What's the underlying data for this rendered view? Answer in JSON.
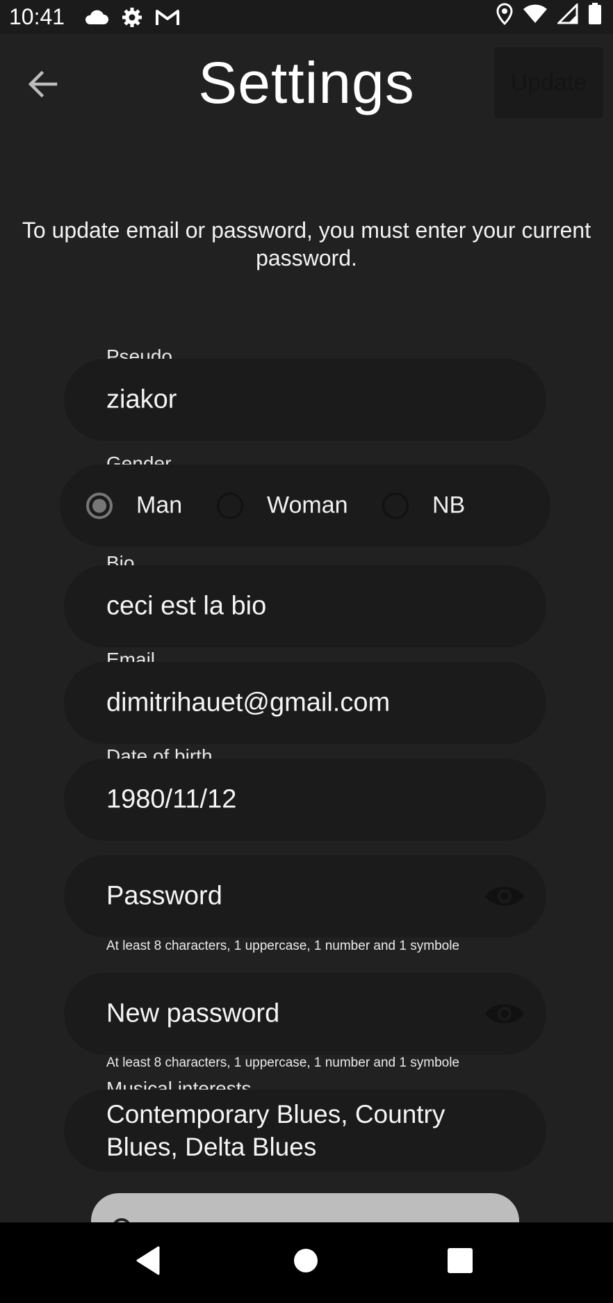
{
  "status_bar": {
    "time": "10:41",
    "left_icons": [
      "cloud-icon",
      "gear-icon",
      "gmail-icon"
    ],
    "right_icons": [
      "location-icon",
      "wifi-icon",
      "signal-icon",
      "battery-icon"
    ]
  },
  "app_bar": {
    "title": "Settings",
    "update_label": "Update",
    "back_icon": "arrow-left-icon"
  },
  "info_text": "To update email or password, you must enter your current password.",
  "form": {
    "pseudo": {
      "label": "Pseudo",
      "value": "ziakor"
    },
    "gender": {
      "label": "Gender",
      "options": [
        {
          "label": "Man",
          "selected": true
        },
        {
          "label": "Woman",
          "selected": false
        },
        {
          "label": "NB",
          "selected": false
        }
      ]
    },
    "bio": {
      "label": "Bio",
      "value": "ceci est la bio"
    },
    "email": {
      "label": "Email",
      "value": "dimitrihauet@gmail.com"
    },
    "dob": {
      "label": "Date of birth",
      "value": "1980/11/12"
    },
    "password": {
      "placeholder": "Password",
      "helper": "At least 8 characters, 1 uppercase, 1 number and 1 symbole",
      "icon": "eye-icon"
    },
    "new_password": {
      "placeholder": "New password",
      "helper": "At least 8 characters, 1 uppercase, 1 number and 1 symbole",
      "icon": "eye-icon"
    },
    "musical_interests": {
      "label": "Musical interests",
      "value": "Contemporary Blues, Country Blues, Delta Blues"
    }
  },
  "nav_bar": {
    "icons": [
      "back-triangle-icon",
      "home-circle-icon",
      "recents-square-icon"
    ]
  },
  "colors": {
    "background": "#212121",
    "field": "#1b1b1b",
    "text": "#f2f2f2",
    "bottom_card": "#bdbdbd"
  }
}
